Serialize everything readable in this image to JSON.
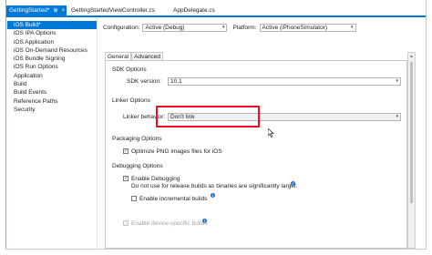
{
  "tabs": [
    {
      "label": "GettingStarted*",
      "pin": "⊕",
      "close": "×"
    },
    {
      "label": "GettingStartedViewController.cs"
    },
    {
      "label": "AppDelegate.cs"
    }
  ],
  "sidebar": {
    "items": [
      {
        "label": "iOS Build*"
      },
      {
        "label": "iOS IPA Options"
      },
      {
        "label": "iOS Application"
      },
      {
        "label": "iOS On-Demand Resources"
      },
      {
        "label": "iOS Bundle Signing"
      },
      {
        "label": "iOS Run Options"
      },
      {
        "label": "Application"
      },
      {
        "label": "Build"
      },
      {
        "label": "Build Events"
      },
      {
        "label": "Reference Paths"
      },
      {
        "label": "Security"
      }
    ]
  },
  "config": {
    "configuration_label": "Configuration:",
    "configuration_value": "Active (Debug)",
    "platform_label": "Platform:",
    "platform_value": "Active (iPhoneSimulator)"
  },
  "subtabs": {
    "general": "General",
    "advanced": "Advanced"
  },
  "sdk": {
    "title": "SDK Options",
    "version_label": "SDK version:",
    "version_value": "10.1"
  },
  "linker": {
    "title": "Linker Options",
    "behavior_label": "Linker behavior:",
    "behavior_value": "Don't link"
  },
  "packaging": {
    "title": "Packaging Options",
    "optimize_png": "Optimize PNG images files for iOS"
  },
  "debugging": {
    "title": "Debugging Options",
    "enable_debugging": "Enable Debugging",
    "enable_debugging_note": "Do not use for release builds as binaries are significantly larger.",
    "incremental": "Enable incremental builds",
    "device_specific": "Enable device-specific builds"
  },
  "icons": {
    "check": "✓",
    "arrow": "▾",
    "info": "i"
  }
}
